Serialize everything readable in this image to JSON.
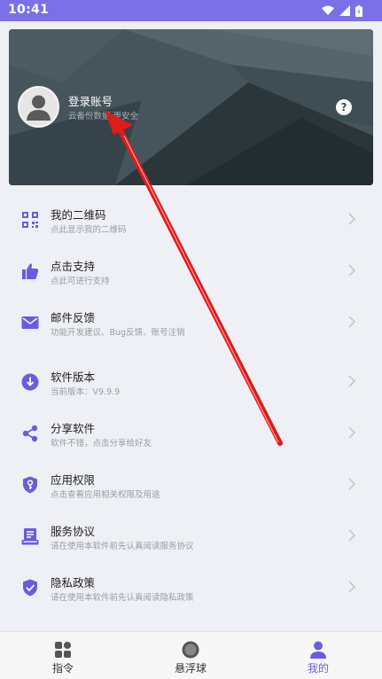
{
  "status_bar": {
    "time": "10:41",
    "icons": [
      "wifi-icon",
      "signal-icon",
      "battery-icon"
    ]
  },
  "colors": {
    "accent": "#7b70e8",
    "icon": "#6a5ce0",
    "header_bg": "#3d4b52",
    "annotation_arrow": "#e01b1b"
  },
  "header": {
    "title": "登录账号",
    "subtitle": "云备份数据 更安全",
    "help": "?"
  },
  "menu": [
    {
      "icon": "qr-code-icon",
      "title": "我的二维码",
      "subtitle": "点此显示我的二维码"
    },
    {
      "icon": "thumbs-up-icon",
      "title": "点击支持",
      "subtitle": "点此可进行支持"
    },
    {
      "icon": "mail-icon",
      "title": "邮件反馈",
      "subtitle": "功能开发建议、Bug反馈、账号注销"
    },
    {
      "icon": "download-icon",
      "title": "软件版本",
      "subtitle": "当前版本：V9.9.9"
    },
    {
      "icon": "share-icon",
      "title": "分享软件",
      "subtitle": "软件不错，点击分享给好友"
    },
    {
      "icon": "shield-key-icon",
      "title": "应用权限",
      "subtitle": "点击查看应用相关权限及用途"
    },
    {
      "icon": "agreement-icon",
      "title": "服务协议",
      "subtitle": "请在使用本软件前先认真阅读服务协议"
    },
    {
      "icon": "shield-check-icon",
      "title": "隐私政策",
      "subtitle": "请在使用本软件前先认真阅读隐私政策"
    }
  ],
  "tabs": [
    {
      "icon": "grid-icon",
      "label": "指令"
    },
    {
      "icon": "floating-ball-icon",
      "label": "悬浮球"
    },
    {
      "icon": "person-icon",
      "label": "我的",
      "active": true
    }
  ]
}
